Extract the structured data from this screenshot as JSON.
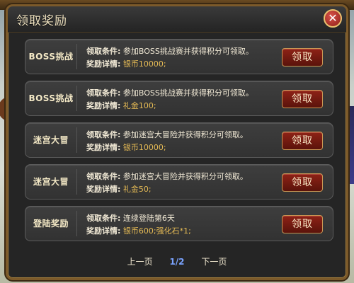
{
  "dialog": {
    "title": "领取奖励",
    "close_icon": "close-icon"
  },
  "labels": {
    "condition": "领取条件:",
    "reward": "奖励详情:",
    "claim": "领取"
  },
  "rewards": [
    {
      "title": "BOSS挑战",
      "condition": "参加BOSS挑战赛并获得积分可领取。",
      "reward": "银币10000;"
    },
    {
      "title": "BOSS挑战",
      "condition": "参加BOSS挑战赛并获得积分可领取。",
      "reward": "礼金100;"
    },
    {
      "title": "迷宫大冒",
      "condition": "参加迷宫大冒险并获得积分可领取。",
      "reward": "银币10000;"
    },
    {
      "title": "迷宫大冒",
      "condition": "参加迷宫大冒险并获得积分可领取。",
      "reward": "礼金50;"
    },
    {
      "title": "登陆奖励",
      "condition": "连续登陆第6天",
      "reward": "银币600;强化石*1;"
    }
  ],
  "pager": {
    "prev": "上一页",
    "current": "1/2",
    "next": "下一页"
  },
  "colors": {
    "reward_text": "#e6bb55",
    "claim_button": "#8e2216",
    "page_indicator": "#7aa3ff"
  }
}
